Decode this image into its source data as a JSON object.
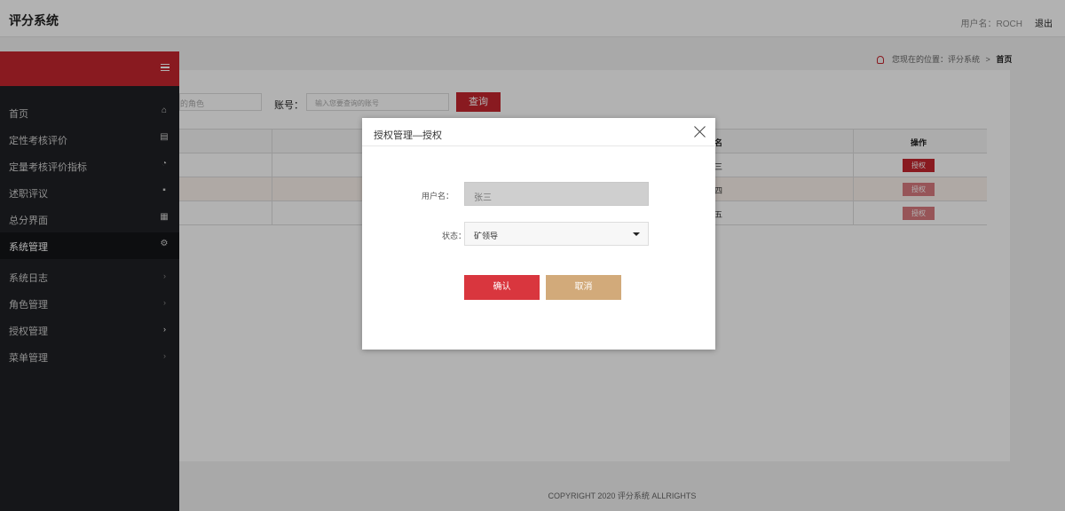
{
  "header": {
    "app_title": "评分系统",
    "user_label": "用户名：ROCH",
    "logout": "退出"
  },
  "sidebar": {
    "items": [
      {
        "label": "首页",
        "icon": "home-icon"
      },
      {
        "label": "定性考核评价",
        "icon": "doc-icon"
      },
      {
        "label": "定量考核评价指标",
        "icon": "chart-icon"
      },
      {
        "label": "述职评议",
        "icon": "chat-icon"
      },
      {
        "label": "总分界面",
        "icon": "score-icon"
      },
      {
        "label": "系统管理",
        "icon": "gear-icon"
      }
    ],
    "subitems": [
      {
        "label": "系统日志"
      },
      {
        "label": "角色管理"
      },
      {
        "label": "授权管理"
      },
      {
        "label": "菜单管理"
      }
    ]
  },
  "breadcrumb": {
    "prefix": "您现在的位置：评分系统",
    "separator": ">",
    "current": "首页"
  },
  "filters": {
    "role_placeholder": "的角色",
    "account_label": "账号：",
    "account_placeholder": "输入您要查询的账号",
    "query_button": "查询"
  },
  "table": {
    "name_header": "名",
    "op_header": "操作",
    "rows": [
      {
        "name": "三",
        "action": "授权"
      },
      {
        "name": "四",
        "action": "授权"
      },
      {
        "name": "五",
        "action": "授权"
      }
    ]
  },
  "footer": {
    "copyright": "COPYRIGHT 2020 评分系统 ALLRIGHTS"
  },
  "modal": {
    "title": "授权管理—授权",
    "username_label": "用户名：",
    "username_value": "张三",
    "status_label": "状态：",
    "status_value": "矿领导",
    "confirm": "确认",
    "cancel": "取消"
  },
  "colors": {
    "brand_red": "#c4262e",
    "confirm_red": "#d9363e",
    "cancel_tan": "#d2aa7a",
    "sidebar_bg": "#1f2024"
  }
}
